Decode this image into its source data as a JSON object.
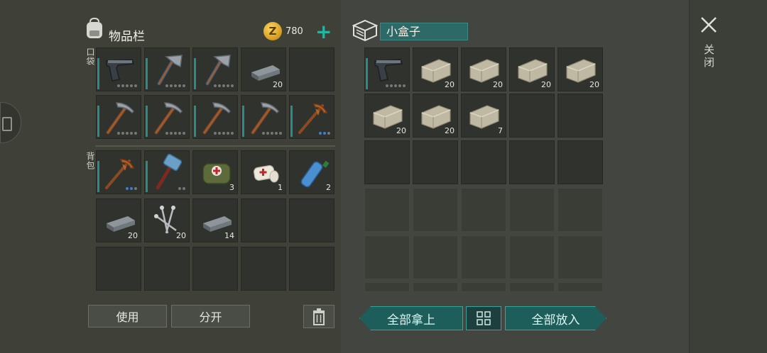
{
  "inventory": {
    "title": "物品栏",
    "coins": "780",
    "pockets_label": "口袋",
    "backpack_label": "背包",
    "use_label": "使用",
    "split_label": "分开"
  },
  "container": {
    "name": "小盒子",
    "take_all_label": "全部拿上",
    "put_all_label": "全部放入"
  },
  "close_label": "关闭",
  "pocket_slots": [
    {
      "item": "pistol",
      "qty": ""
    },
    {
      "item": "hatchet",
      "qty": ""
    },
    {
      "item": "hatchet",
      "qty": ""
    },
    {
      "item": "iron-bar",
      "qty": "20"
    },
    {
      "item": "empty",
      "qty": ""
    },
    {
      "item": "pickaxe",
      "qty": ""
    },
    {
      "item": "pickaxe",
      "qty": ""
    },
    {
      "item": "pickaxe",
      "qty": ""
    },
    {
      "item": "pickaxe",
      "qty": ""
    },
    {
      "item": "copper-pickaxe",
      "qty": ""
    }
  ],
  "backpack_slots": [
    {
      "item": "copper-pickaxe",
      "qty": ""
    },
    {
      "item": "sledgehammer",
      "qty": ""
    },
    {
      "item": "first-aid-kit",
      "qty": "3"
    },
    {
      "item": "bandage",
      "qty": "1"
    },
    {
      "item": "water-bottle",
      "qty": "2"
    },
    {
      "item": "iron-bar",
      "qty": "20"
    },
    {
      "item": "nails",
      "qty": "20"
    },
    {
      "item": "iron-bar",
      "qty": "14"
    }
  ],
  "box_slots": [
    {
      "item": "pistol",
      "qty": ""
    },
    {
      "item": "stone",
      "qty": "20"
    },
    {
      "item": "stone",
      "qty": "20"
    },
    {
      "item": "stone",
      "qty": "20"
    },
    {
      "item": "stone",
      "qty": "20"
    },
    {
      "item": "stone",
      "qty": "20"
    },
    {
      "item": "stone",
      "qty": "20"
    },
    {
      "item": "stone",
      "qty": "7"
    }
  ]
}
